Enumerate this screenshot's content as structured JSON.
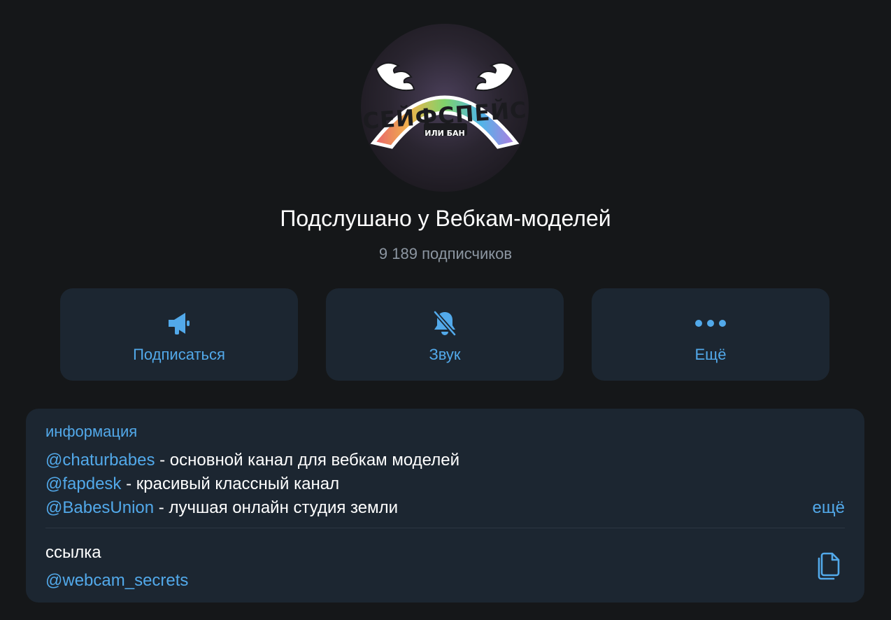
{
  "channel": {
    "avatar_title": "СЕЙФСПЕЙС",
    "avatar_subtitle": "ИЛИ БАН",
    "name": "Подслушано у Вебкам-моделей",
    "subscribers": "9 189 подписчиков"
  },
  "actions": [
    {
      "label": "Подписаться",
      "icon": "megaphone-icon"
    },
    {
      "label": "Звук",
      "icon": "bell-off-icon"
    },
    {
      "label": "Ещё",
      "icon": "more-dots-icon"
    }
  ],
  "info": {
    "heading": "информация",
    "lines": [
      {
        "mention": "@chaturbabes",
        "text": " - основной канал для вебкам моделей"
      },
      {
        "mention": "@fapdesk",
        "text": " - красивый классный канал"
      },
      {
        "mention": "@BabesUnion",
        "text": " - лучшая онлайн студия земли"
      }
    ],
    "more_label": "ещё",
    "link_label": "ссылка",
    "link_value": "@webcam_secrets",
    "copy_icon": "copy-icon"
  },
  "colors": {
    "background": "#151719",
    "card": "#1c2631",
    "accent": "#52a9ea",
    "muted": "#8c96a1"
  }
}
